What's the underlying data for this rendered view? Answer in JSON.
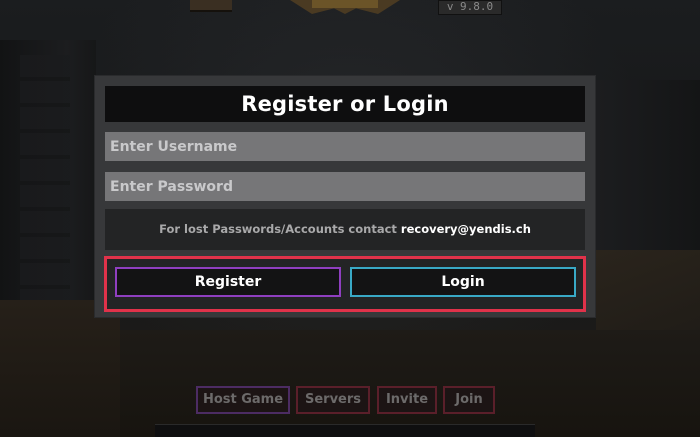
{
  "header": {
    "version": "v 9.8.0"
  },
  "dialog": {
    "title": "Register or Login",
    "username_placeholder": "Enter Username",
    "password_placeholder": "Enter Password",
    "info_text": "For lost Passwords/Accounts contact",
    "info_email": "recovery@yendis.ch",
    "register_label": "Register",
    "login_label": "Login"
  },
  "nav": {
    "host_game": "Host Game",
    "servers": "Servers",
    "invite": "Invite",
    "join": "Join"
  },
  "colors": {
    "panel": "#37383a",
    "field": "#767678",
    "highlight_frame": "#e0324a",
    "register_border": "#8f3fc0",
    "login_border": "#39a9c6"
  }
}
